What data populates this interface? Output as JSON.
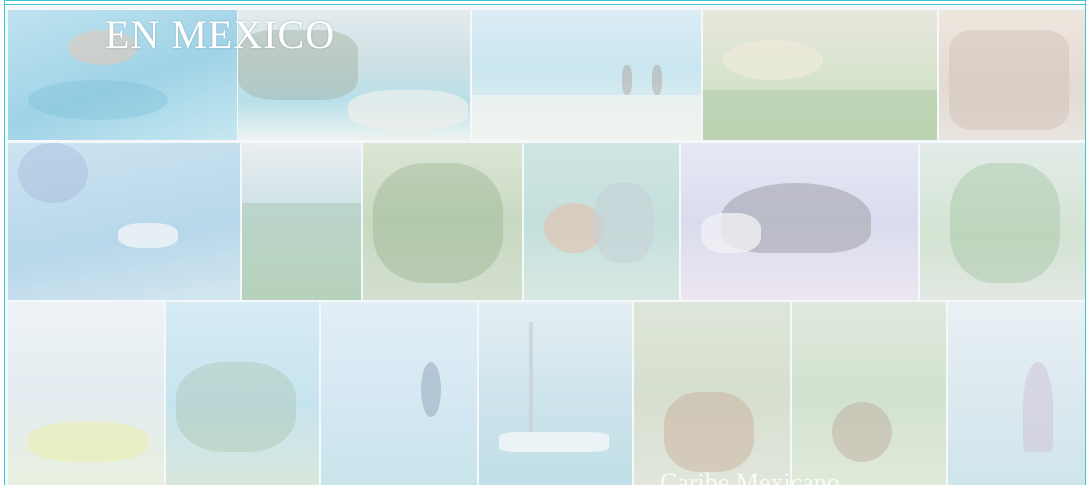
{
  "banner": {
    "title": "EN MEXICO",
    "subtitle": "Caribe Mexicano",
    "border_color": "#3fc6d6"
  },
  "photos": [
    {
      "name": "photo-snorkeling",
      "icon": "swimmer-with-fish"
    },
    {
      "name": "photo-coastal-ruins",
      "icon": "cliff-ruins-beach"
    },
    {
      "name": "photo-beach-couple",
      "icon": "couple-walking-beach"
    },
    {
      "name": "photo-golf-course",
      "icon": "golf-green"
    },
    {
      "name": "photo-street-crowd",
      "icon": "town-street"
    },
    {
      "name": "photo-parasailing",
      "icon": "parasail-speedboat"
    },
    {
      "name": "photo-resort-aerial",
      "icon": "resort-pool"
    },
    {
      "name": "photo-jungle",
      "icon": "tropical-jungle"
    },
    {
      "name": "photo-dolphin-swim",
      "icon": "woman-with-dolphin"
    },
    {
      "name": "photo-sombrero",
      "icon": "mariachi-sombrero"
    },
    {
      "name": "photo-marina-palms",
      "icon": "palm-marina"
    },
    {
      "name": "photo-kayak",
      "icon": "kayaker"
    },
    {
      "name": "photo-palm-trees",
      "icon": "palm-trees-sky"
    },
    {
      "name": "photo-kitesurf",
      "icon": "kitesurfer"
    },
    {
      "name": "photo-sailboats",
      "icon": "sailboats"
    },
    {
      "name": "photo-tropical-people",
      "icon": "people-under-trees"
    },
    {
      "name": "photo-zipline",
      "icon": "zipline-jungle"
    },
    {
      "name": "photo-catamaran",
      "icon": "catamaran-sail"
    }
  ]
}
